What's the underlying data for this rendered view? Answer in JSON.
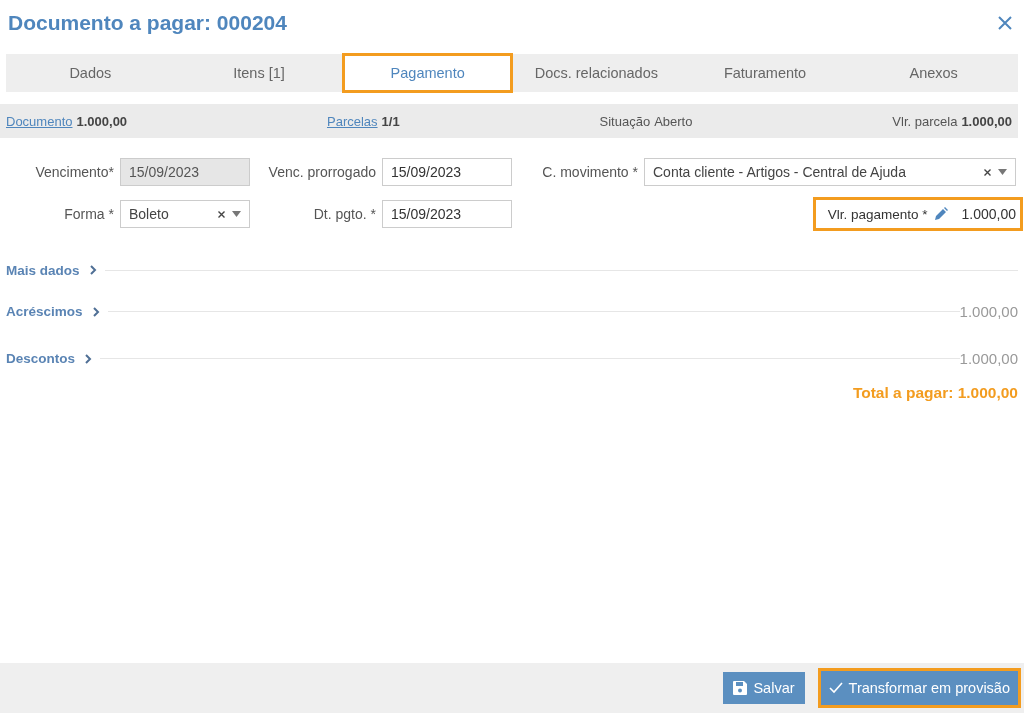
{
  "window": {
    "title": "Documento a pagar: 000204"
  },
  "tabs": [
    {
      "label": "Dados",
      "selected": false,
      "highlighted": false
    },
    {
      "label": "Itens [1]",
      "selected": false,
      "highlighted": false
    },
    {
      "label": "Pagamento",
      "selected": true,
      "highlighted": true
    },
    {
      "label": "Docs. relacionados",
      "selected": false,
      "highlighted": false
    },
    {
      "label": "Faturamento",
      "selected": false,
      "highlighted": false
    },
    {
      "label": "Anexos",
      "selected": false,
      "highlighted": false
    }
  ],
  "summary": [
    {
      "kind": "link",
      "label": "Documento",
      "value": "1.000,00"
    },
    {
      "kind": "link",
      "label": "Parcelas",
      "value": "1/1"
    },
    {
      "kind": "plain",
      "label": "Situação",
      "value": "Aberto"
    },
    {
      "kind": "plain",
      "label": "Vlr. parcela",
      "value": "1.000,00"
    }
  ],
  "fields": [
    {
      "kind": "text",
      "label": "Vencimento*",
      "value": "15/09/2023",
      "disabled": true
    },
    {
      "kind": "text",
      "label": "Venc. prorrogado",
      "value": "15/09/2023",
      "disabled": false
    },
    {
      "kind": "select",
      "label": "C. movimento *",
      "value": "Conta cliente - Artigos - Central de Ajuda"
    },
    {
      "kind": "select",
      "label": "Forma *",
      "value": "Boleto"
    },
    {
      "kind": "text",
      "label": "Dt. pgto. *",
      "value": "15/09/2023",
      "disabled": false
    }
  ],
  "payment": {
    "label": "Vlr. pagamento *",
    "value": "1.000,00",
    "highlighted": true
  },
  "sections": [
    {
      "label": "Mais dados",
      "expanded": false
    },
    {
      "label": "Acréscimos",
      "expanded": false,
      "amount": "1.000,00"
    },
    {
      "label": "Descontos",
      "expanded": false,
      "amount": "1.000,00"
    }
  ],
  "total": "Total a pagar: 1.000,00",
  "buttons": [
    {
      "kind": "save",
      "label": "Salvar",
      "highlighted": false
    },
    {
      "kind": "confirm",
      "label": "Transformar em provisão",
      "highlighted": true
    }
  ]
}
